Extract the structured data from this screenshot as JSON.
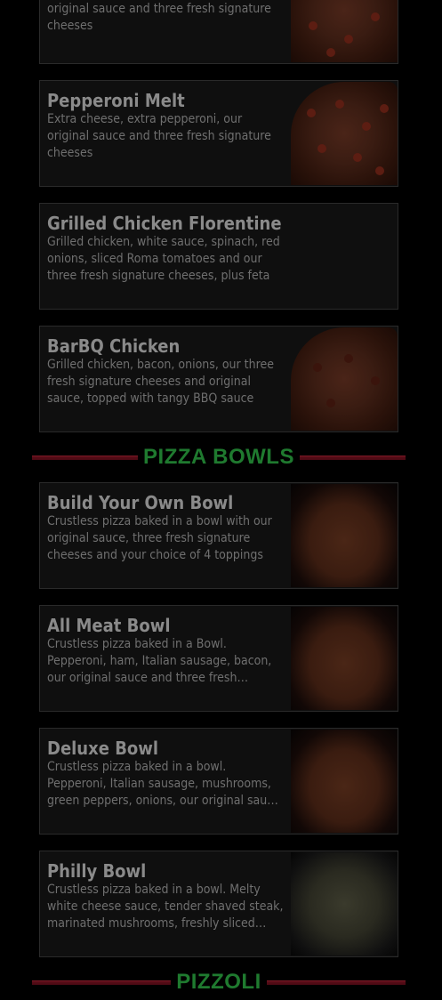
{
  "items": [
    {
      "title": "",
      "description": "Pepperoni, ham, green peppers, Italian sausage, mushrooms, bacon, onions, our original sauce and three fresh signature cheeses",
      "image": "pizza-photo"
    },
    {
      "title": "Pepperoni Melt",
      "description": "Extra cheese, extra pepperoni, our original sauce and three fresh signature cheeses",
      "image": "pizza-photo"
    },
    {
      "title": "Grilled Chicken Florentine",
      "description": "Grilled chicken, white sauce, spinach, red onions, sliced Roma tomatoes and our three fresh signature cheeses, plus feta",
      "image": ""
    },
    {
      "title": "BarBQ Chicken",
      "description": "Grilled chicken, bacon, onions, our three fresh signature cheeses and original sauce, topped with tangy BBQ sauce",
      "image": "pizza-photo"
    }
  ],
  "sections": {
    "bowls": "PIZZA BOWLS",
    "pizzoli": "PIZZOLI"
  },
  "bowls": [
    {
      "title": "Build Your Own Bowl",
      "description": "Crustless pizza baked in a bowl with our original sauce, three fresh signature cheeses and your choice of 4 toppings",
      "image": "bowl-photo"
    },
    {
      "title": "All Meat Bowl",
      "description": "Crustless pizza baked in a Bowl. Pepperoni, ham, Italian sausage, bacon, our original sauce and three fresh signature cheeses",
      "image": "bowl-photo"
    },
    {
      "title": "Deluxe Bowl",
      "description": "Crustless pizza baked in a bowl. Pepperoni, Italian sausage, mushrooms, green peppers, onions, our original sauce and three fresh signature cheeses",
      "image": "bowl-photo"
    },
    {
      "title": "Philly Bowl",
      "description": "Crustless pizza baked in a bowl. Melty white cheese sauce, tender shaved steak, marinated mushrooms, freshly sliced onions and green peppers",
      "image": "bowl-photo"
    }
  ],
  "colors": {
    "section_label": "#1f7a2f",
    "section_line": "#5a0d18"
  }
}
